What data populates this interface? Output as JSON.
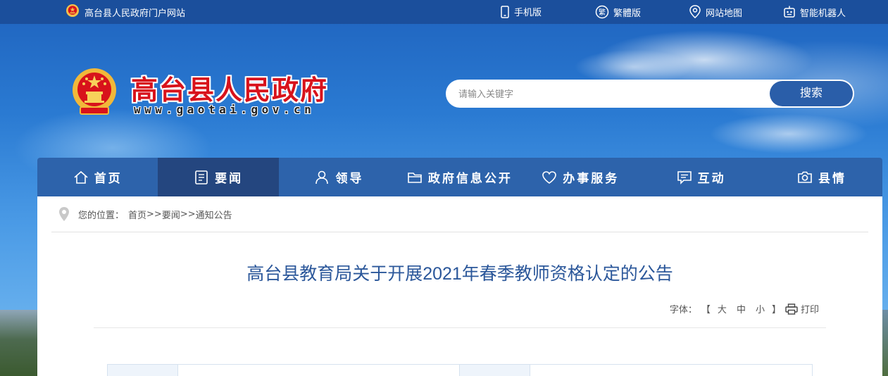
{
  "topbar": {
    "site_name": "高台县人民政府门户网站",
    "links": [
      {
        "label": "手机版",
        "icon": "mobile-icon"
      },
      {
        "label": "繁體版",
        "icon": "traditional-chinese-icon"
      },
      {
        "label": "网站地图",
        "icon": "map-pin-icon"
      },
      {
        "label": "智能机器人",
        "icon": "robot-icon"
      }
    ]
  },
  "logo": {
    "title": "高台县人民政府",
    "url": "www.gaotai.gov.cn"
  },
  "search": {
    "placeholder": "请输入关键字",
    "button": "搜索"
  },
  "nav": {
    "items": [
      {
        "label": "首页",
        "icon": "home-icon"
      },
      {
        "label": "要闻",
        "icon": "news-icon",
        "active": true
      },
      {
        "label": "领导",
        "icon": "person-icon"
      },
      {
        "label": "政府信息公开",
        "icon": "folder-icon"
      },
      {
        "label": "办事服务",
        "icon": "heart-icon"
      },
      {
        "label": "互动",
        "icon": "chat-icon"
      },
      {
        "label": "县情",
        "icon": "camera-icon"
      }
    ]
  },
  "breadcrumb": {
    "prefix": "您的位置：",
    "items": [
      "首页",
      "要闻",
      "通知公告"
    ],
    "sep": ">>"
  },
  "article": {
    "title": "高台县教育局关于开展2021年春季教师资格认定的公告"
  },
  "tools": {
    "font_label": "字体：",
    "open_bracket": "【",
    "sizes": [
      "大",
      "中",
      "小"
    ],
    "close_bracket": "】",
    "print": "打印"
  },
  "colors": {
    "topbar": "#1b4f9c",
    "nav": "#2d63ab",
    "nav_active": "#24467f",
    "title": "#2b579a",
    "logo_red": "#d8121b"
  }
}
